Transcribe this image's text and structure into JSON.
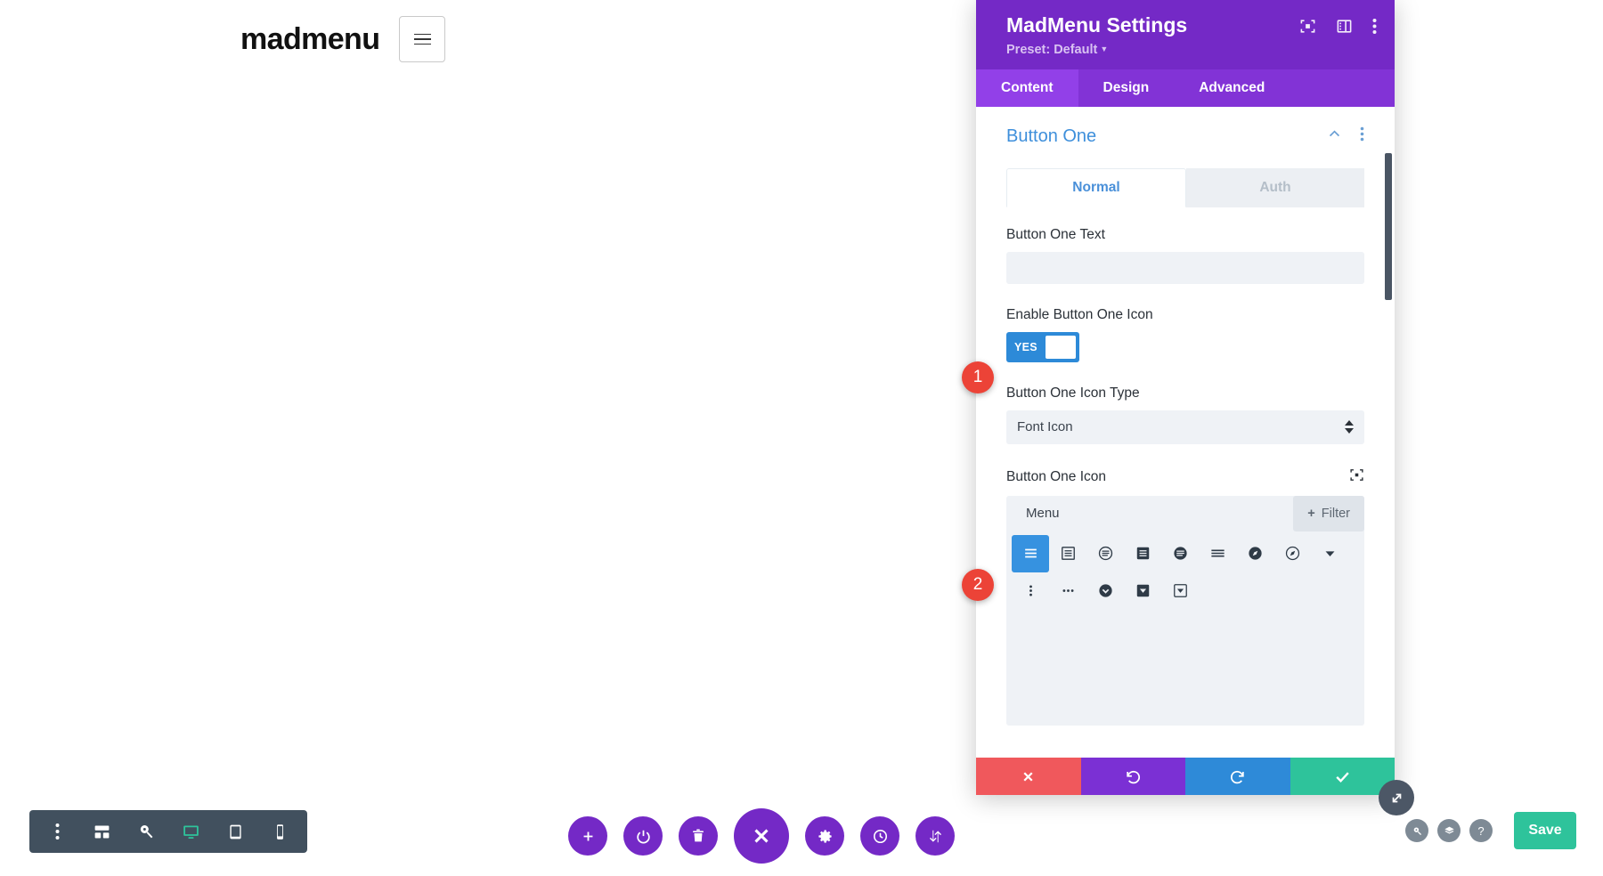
{
  "canvas": {
    "logo_text": "madmenu",
    "hamburger_icon": "hamburger-icon"
  },
  "settings_panel": {
    "title": "MadMenu Settings",
    "preset_label": "Preset: Default",
    "header_icons": [
      {
        "name": "focus-icon"
      },
      {
        "name": "layout-panel-icon"
      },
      {
        "name": "more-vertical-icon"
      }
    ],
    "tabs": [
      {
        "label": "Content",
        "active": true
      },
      {
        "label": "Design",
        "active": false
      },
      {
        "label": "Advanced",
        "active": false
      }
    ],
    "section": {
      "title": "Button One",
      "collapse_icon": "chevron-up-icon",
      "more_icon": "more-vertical-icon"
    },
    "state_tabs": [
      {
        "label": "Normal",
        "active": true
      },
      {
        "label": "Auth",
        "active": false
      }
    ],
    "fields": {
      "button_text": {
        "label": "Button One Text",
        "value": "",
        "placeholder": ""
      },
      "enable_icon": {
        "label": "Enable Button One Icon",
        "toggle_label": "YES",
        "value": "YES"
      },
      "icon_type": {
        "label": "Button One Icon Type",
        "value": "Font Icon"
      },
      "icon_picker": {
        "label": "Button One Icon",
        "reset_icon": "focus-icon",
        "search_value": "Menu",
        "filter_label": "Filter",
        "filter_icon": "plus-icon",
        "icons_row1": [
          {
            "name": "hamburger-icon",
            "selected": true
          },
          {
            "name": "box-lines-icon",
            "selected": false
          },
          {
            "name": "circle-lines-icon",
            "selected": false
          },
          {
            "name": "box-filled-lines-icon",
            "selected": false
          },
          {
            "name": "circle-filled-lines-icon",
            "selected": false
          },
          {
            "name": "bars-icon",
            "selected": false
          },
          {
            "name": "compass-filled-icon",
            "selected": false
          },
          {
            "name": "compass-outline-icon",
            "selected": false
          },
          {
            "name": "caret-down-icon",
            "selected": false
          }
        ],
        "icons_row2": [
          {
            "name": "more-vertical-icon",
            "selected": false
          },
          {
            "name": "more-horizontal-icon",
            "selected": false
          },
          {
            "name": "circle-chevron-down-icon",
            "selected": false
          },
          {
            "name": "square-filled-caret-down-icon",
            "selected": false
          },
          {
            "name": "square-outline-caret-down-icon",
            "selected": false
          }
        ]
      }
    },
    "actions": [
      {
        "name": "cancel-button",
        "icon": "close-icon",
        "color": "#f0585c"
      },
      {
        "name": "undo-button",
        "icon": "undo-icon",
        "color": "#7b30d4"
      },
      {
        "name": "redo-button",
        "icon": "redo-icon",
        "color": "#2e8ad8"
      },
      {
        "name": "confirm-button",
        "icon": "check-icon",
        "color": "#2ec39b"
      }
    ],
    "resize_handle_icon": "resize-diagonal-icon"
  },
  "step_badges": [
    {
      "number": "1"
    },
    {
      "number": "2"
    }
  ],
  "bottom_bar": {
    "left_tools": [
      {
        "name": "more-vertical-icon",
        "active": false
      },
      {
        "name": "wireframe-icon",
        "active": false
      },
      {
        "name": "zoom-icon",
        "active": false
      },
      {
        "name": "desktop-icon",
        "active": true
      },
      {
        "name": "tablet-icon",
        "active": false
      },
      {
        "name": "mobile-icon",
        "active": false
      }
    ],
    "center_tools": [
      {
        "name": "add-icon",
        "big": false
      },
      {
        "name": "power-icon",
        "big": false
      },
      {
        "name": "trash-icon",
        "big": false
      },
      {
        "name": "close-icon",
        "big": true
      },
      {
        "name": "gear-icon",
        "big": false
      },
      {
        "name": "history-icon",
        "big": false
      },
      {
        "name": "sort-icon",
        "big": false
      }
    ],
    "right_tools": [
      {
        "name": "search-icon",
        "glyph": "search"
      },
      {
        "name": "layers-icon",
        "glyph": "layers"
      },
      {
        "name": "help-icon",
        "glyph": "?"
      }
    ],
    "save_label": "Save"
  },
  "colors": {
    "brand_purple": "#7429c6",
    "tab_purple": "#8233d6",
    "tab_active_purple": "#9240e8",
    "accent_blue": "#3e8fdb",
    "toggle_blue": "#2d8ad8",
    "badge_red": "#ec4337",
    "save_green": "#2ec39b",
    "toolbar_dark": "#41505e"
  }
}
